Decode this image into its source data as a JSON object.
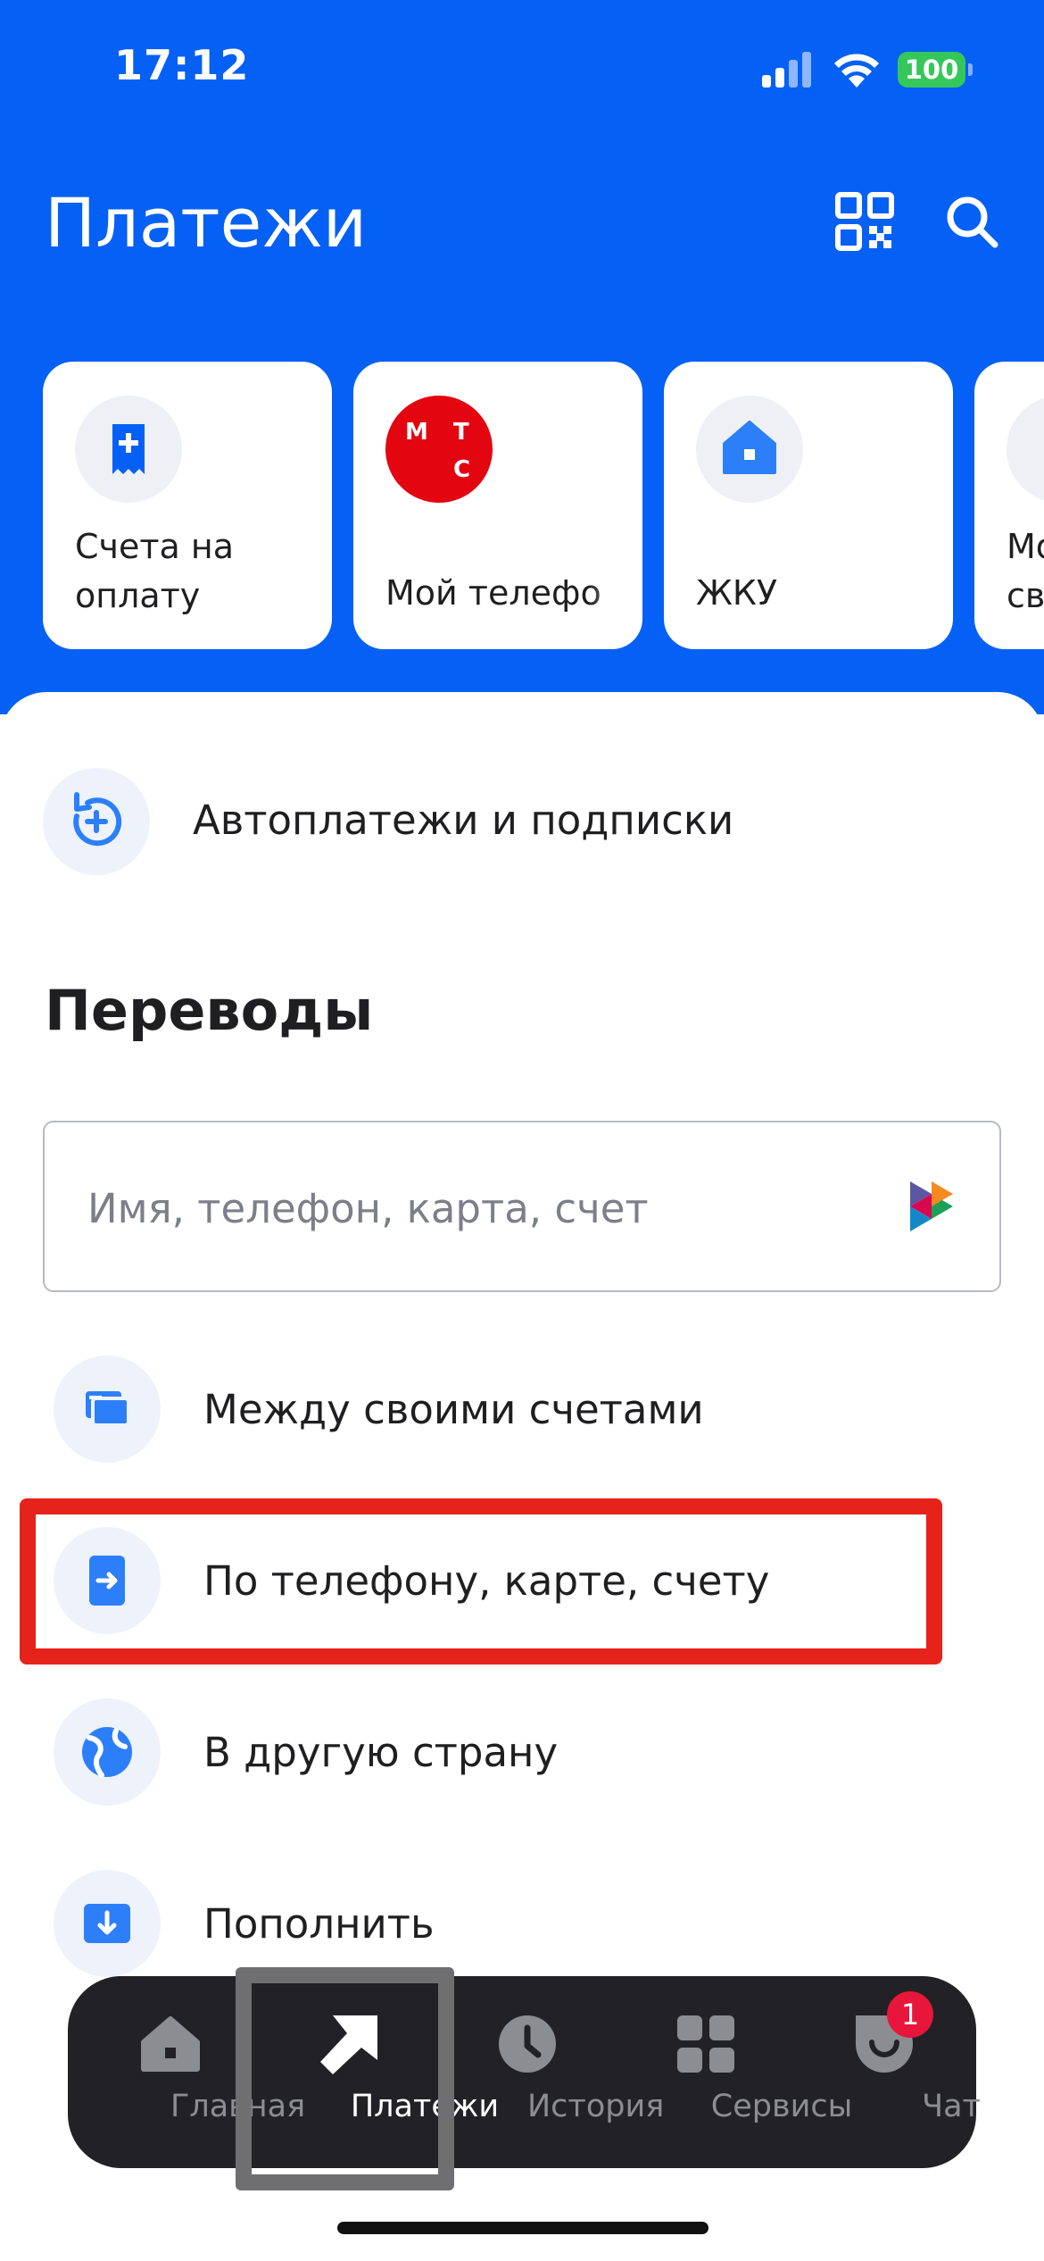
{
  "status_bar": {
    "time": "17:12",
    "battery": "100"
  },
  "header": {
    "title": "Платежи",
    "qr_icon": "qr-code-icon",
    "search_icon": "search-icon"
  },
  "quick_cards": [
    {
      "label": "Счета на оплату",
      "line1": "Счета на",
      "line2": "оплату",
      "icon": "invoice-icon"
    },
    {
      "label": "Мой телефон",
      "visible_text": "Мой телефо",
      "logo_text": [
        "М",
        "Т",
        "С"
      ]
    },
    {
      "label": "ЖКУ",
      "icon": "house-icon"
    },
    {
      "line1": "Мо",
      "line2": "св"
    }
  ],
  "autopay": {
    "label": "Автоплатежи и подписки",
    "icon": "autopay-refresh-icon"
  },
  "transfers": {
    "title": "Переводы",
    "search_placeholder": "Имя, телефон, карта, счет",
    "rows": [
      {
        "label": "Между своими счетами",
        "icon": "cards-icon"
      },
      {
        "label": "По телефону, карте, счету",
        "icon": "phone-transfer-icon"
      },
      {
        "label": "В другую страну",
        "icon": "globe-icon"
      },
      {
        "label": "Пополнить",
        "icon": "download-icon"
      }
    ]
  },
  "tabbar": {
    "tabs": [
      {
        "label": "Главная",
        "icon": "home-icon"
      },
      {
        "label": "Платежи",
        "icon": "arrow-icon",
        "active": true
      },
      {
        "label": "История",
        "icon": "clock-icon"
      },
      {
        "label": "Сервисы",
        "icon": "grid-icon"
      },
      {
        "label": "Чат",
        "icon": "chat-icon",
        "badge": "1"
      }
    ]
  },
  "colors": {
    "brand_blue": "#0560f5",
    "highlight_red": "#e5231b",
    "tabbar_bg": "#222226"
  }
}
